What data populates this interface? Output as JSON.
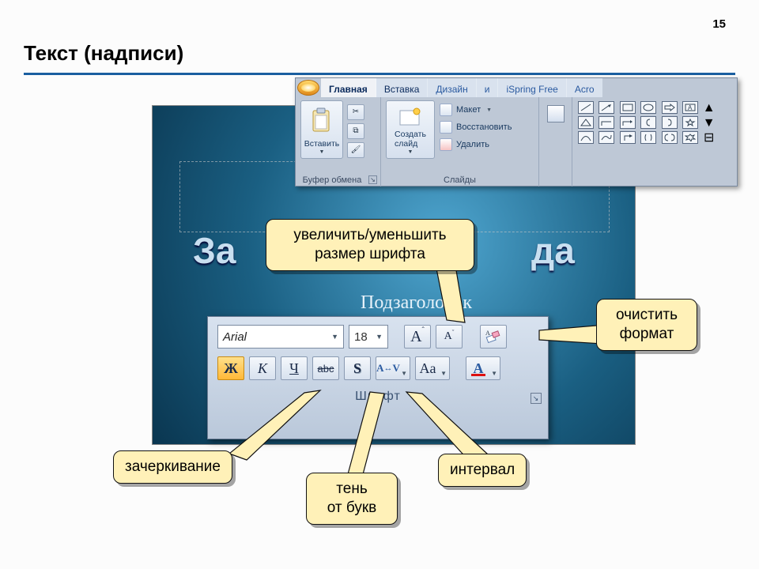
{
  "page": {
    "number": "15",
    "title": "Текст (надписи)"
  },
  "ribbon": {
    "tabs": [
      "Главная",
      "Вставка",
      "Дизайн",
      "и",
      "iSpring Free",
      "Acro"
    ],
    "paste": "Вставить",
    "new_slide": "Создать\nслайд",
    "layout": "Макет",
    "reset": "Восстановить",
    "delete": "Удалить",
    "group_clipboard": "Буфер обмена",
    "group_slides": "Слайды"
  },
  "slide": {
    "title_fragment_left": "За",
    "title_fragment_right": "да",
    "subtitle": "Подзаголовок слайда"
  },
  "font_panel": {
    "font": "Arial",
    "size": "18",
    "bold": "Ж",
    "italic": "К",
    "underline": "Ч",
    "strike": "abc",
    "shadow": "S",
    "spacing": "AV",
    "case": "Aa",
    "color": "A",
    "label": "Шрифт"
  },
  "callouts": {
    "size": "увеличить/уменьшить\nразмер шрифта",
    "clear": "очистить\nформат",
    "strike": "зачеркивание",
    "shadow": "тень\nот букв",
    "spacing": "интервал"
  }
}
